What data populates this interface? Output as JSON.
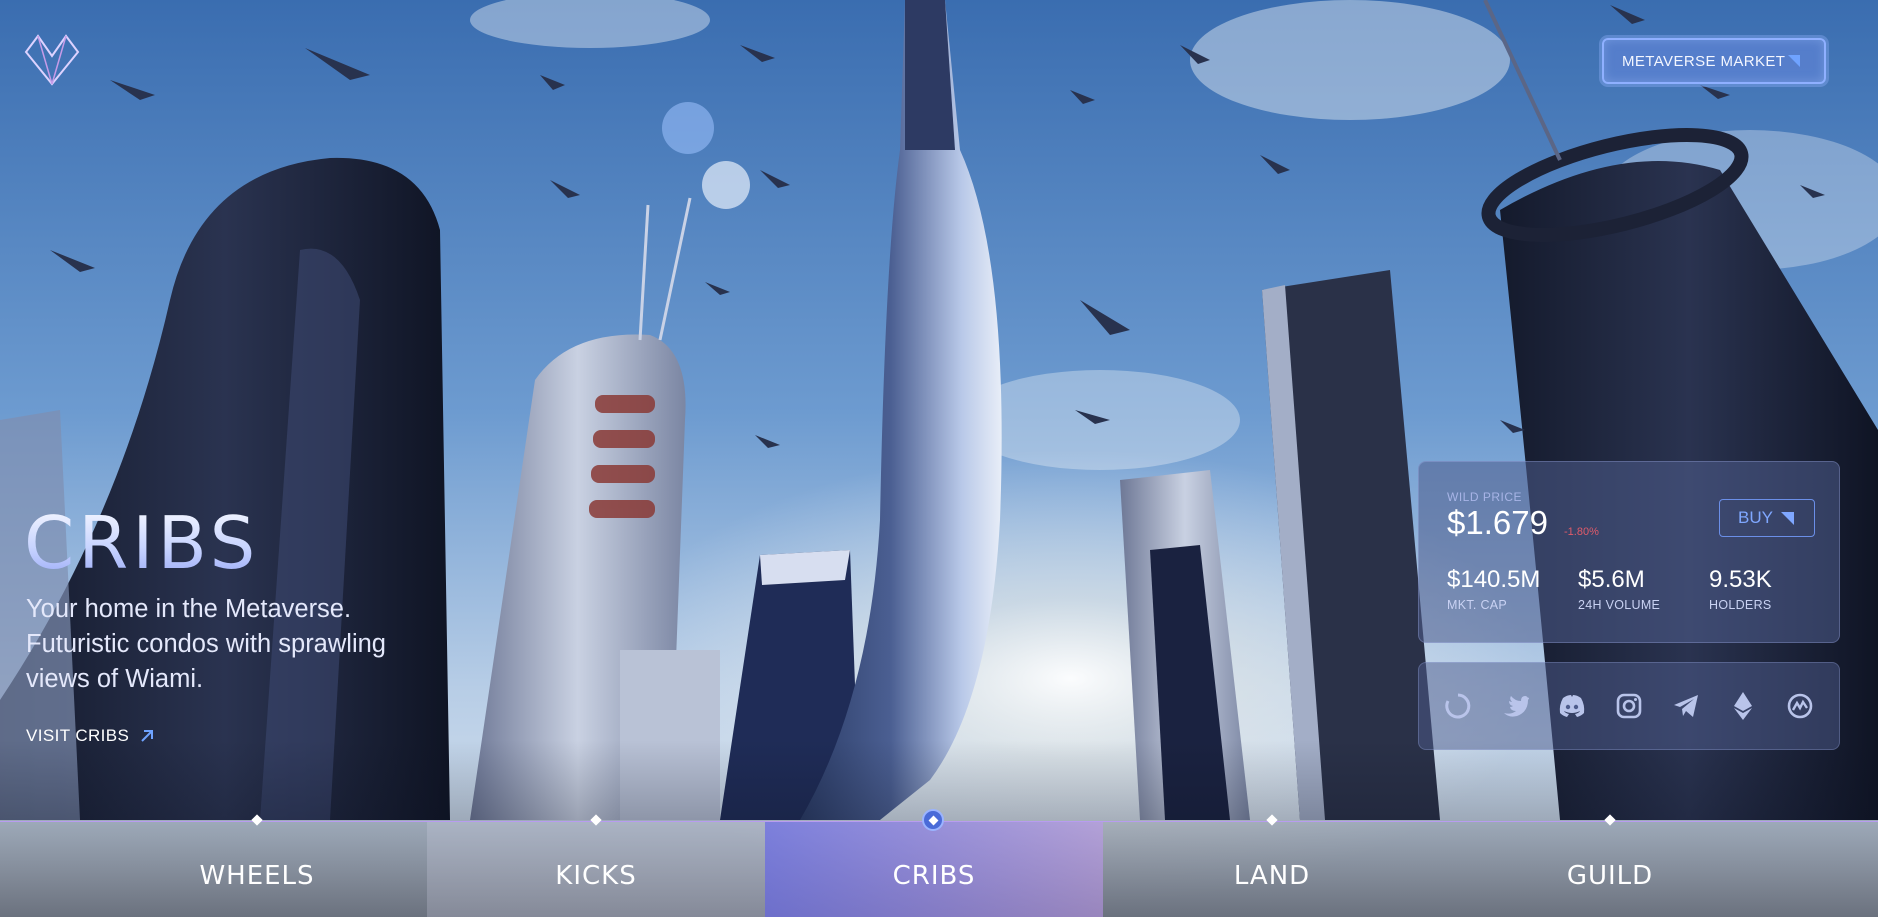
{
  "brand": {
    "logo_icon": "wiami-logo-icon"
  },
  "header": {
    "market_button_label": "METAVERSE MARKET"
  },
  "hero": {
    "title": "CRIBS",
    "description": "Your home in the Metaverse. Futuristic condos with sprawling views of Wiami.",
    "link_label": "VISIT CRIBS",
    "link_icon": "arrow-up-right-icon"
  },
  "stats": {
    "price_label": "WILD PRICE",
    "price": "$1.679",
    "change": "-1.80%",
    "buy_label": "BUY",
    "items": [
      {
        "value": "$140.5M",
        "label": "MKT. CAP"
      },
      {
        "value": "$5.6M",
        "label": "24H VOLUME"
      },
      {
        "value": "9.53K",
        "label": "HOLDERS"
      }
    ]
  },
  "social": [
    {
      "icon": "circle-icon"
    },
    {
      "icon": "twitter-icon"
    },
    {
      "icon": "discord-icon"
    },
    {
      "icon": "instagram-icon"
    },
    {
      "icon": "telegram-icon"
    },
    {
      "icon": "ethereum-icon"
    },
    {
      "icon": "coinmarketcap-icon"
    }
  ],
  "nav": {
    "tabs": [
      {
        "label": "WHEELS",
        "active": false
      },
      {
        "label": "KICKS",
        "active": false
      },
      {
        "label": "CRIBS",
        "active": true
      },
      {
        "label": "LAND",
        "active": false
      },
      {
        "label": "GUILD",
        "active": false
      }
    ]
  },
  "colors": {
    "accent": "#6fa3ff",
    "negative": "#e05b6a",
    "nav_line": "#b89cf0"
  }
}
